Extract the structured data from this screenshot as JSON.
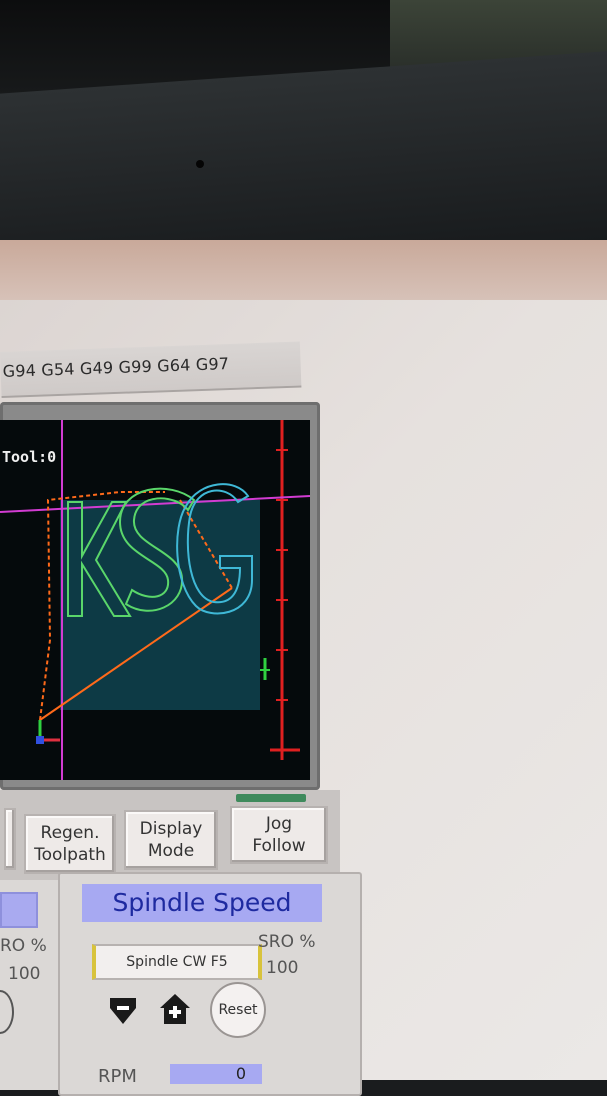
{
  "gcode_modes": "G94 G54 G49 G99 G64 G97",
  "toolpath_view": {
    "tool_label": "Tool:0",
    "part_text": "KSG"
  },
  "buttons": {
    "regen_line1": "Regen.",
    "regen_line2": "Toolpath",
    "display_line1": "Display",
    "display_line2": "Mode",
    "jog_line1": "Jog",
    "jog_line2": "Follow"
  },
  "left_panel": {
    "fro_label": "RO %",
    "fro_value": "100"
  },
  "spindle": {
    "title": "Spindle Speed",
    "cw_button": "Spindle CW F5",
    "sro_label": "SRO %",
    "sro_value": "100",
    "reset_label": "Reset",
    "rpm_label": "RPM",
    "rpm_value": "0",
    "decrease_icon": "arrow-down-icon",
    "increase_icon": "plus-icon"
  },
  "colors": {
    "toolpath_bg": "#050a0c",
    "letter_outline": "#5ad66a",
    "rapid_move": "#ff6a1a",
    "axis_magenta": "#d23cd2",
    "spindle_title_bg": "#a7a9f2"
  }
}
